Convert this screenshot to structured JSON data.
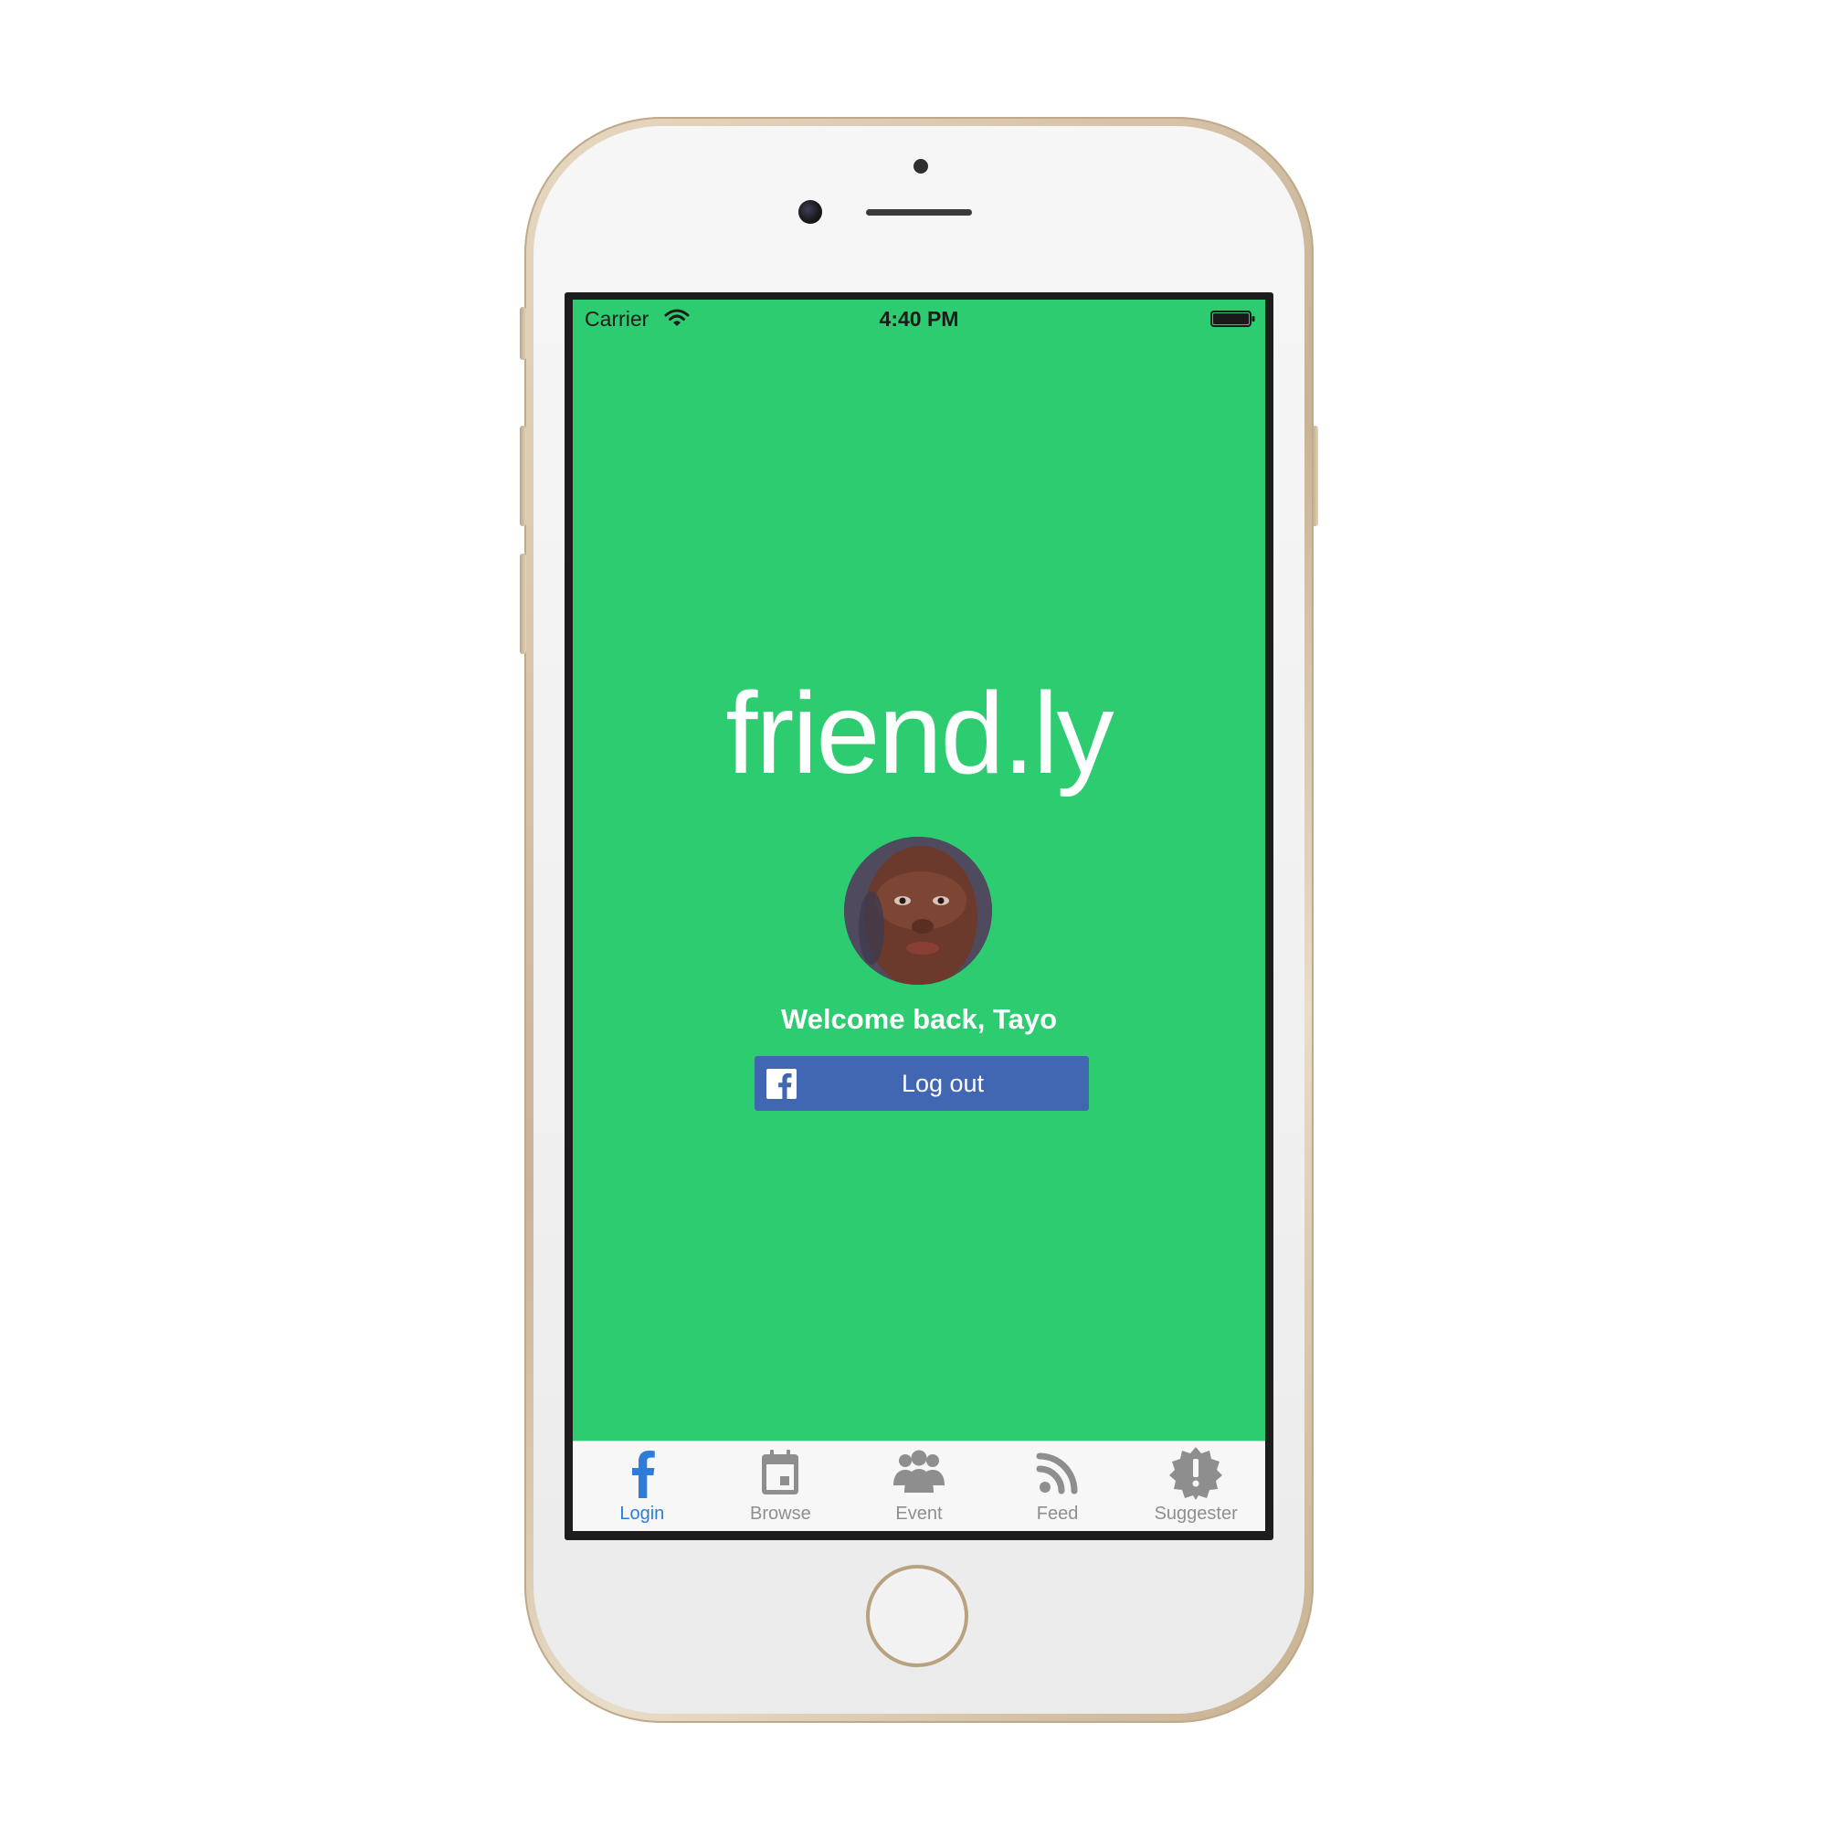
{
  "status_bar": {
    "carrier": "Carrier",
    "time": "4:40 PM"
  },
  "app": {
    "title": "friend.ly",
    "welcome": "Welcome back, Tayo",
    "logout_label": "Log out"
  },
  "tabs": [
    {
      "label": "Login",
      "icon": "facebook-icon",
      "active": true
    },
    {
      "label": "Browse",
      "icon": "calendar-icon",
      "active": false
    },
    {
      "label": "Event",
      "icon": "group-icon",
      "active": false
    },
    {
      "label": "Feed",
      "icon": "rss-feed-icon",
      "active": false
    },
    {
      "label": "Suggester",
      "icon": "alert-badge-icon",
      "active": false
    }
  ],
  "colors": {
    "background": "#2ecc71",
    "facebook_blue": "#4267b2",
    "tab_active": "#2f7bd9",
    "tab_inactive": "#8e8e8e"
  }
}
